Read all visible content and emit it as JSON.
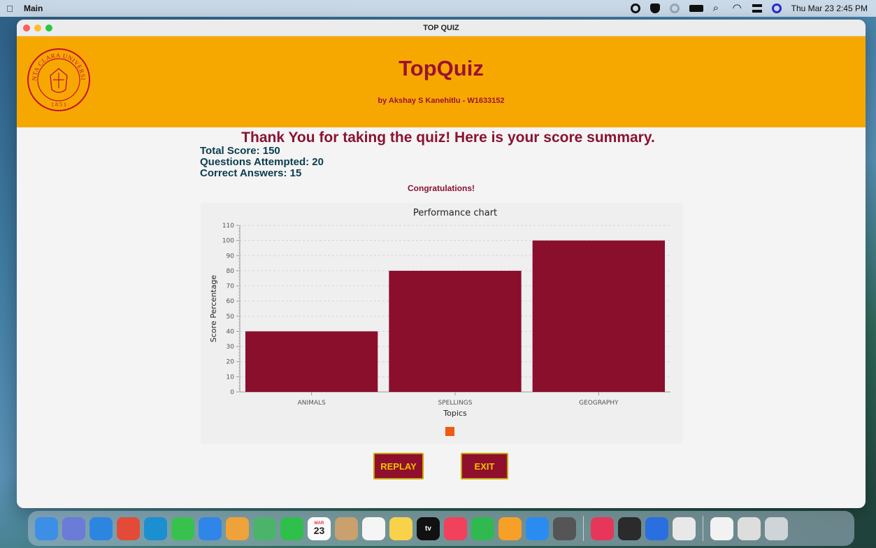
{
  "menubar": {
    "app_name": "Main",
    "clock": "Thu Mar 23  2:45 PM"
  },
  "window": {
    "title": "TOP QUIZ"
  },
  "header": {
    "title": "TopQuiz",
    "subtitle": "by Akshay S Kanehitlu - W1633152",
    "logo": "santa-clara-university-seal",
    "logo_text": "SANTA CLARA UNIVERSITY",
    "logo_year": "1 8 5 1"
  },
  "summary": {
    "heading": "Thank You for taking the quiz! Here is your score summary.",
    "total_score": "Total Score: 150",
    "questions_attempted": "Questions Attempted: 20",
    "correct_answers": "Correct Answers: 15",
    "message": "Congratulations!"
  },
  "chart_data": {
    "type": "bar",
    "title": "Performance chart",
    "xlabel": "Topics",
    "ylabel": "Score Percentage",
    "categories": [
      "ANIMALS",
      "SPELLINGS",
      "GEOGRAPHY"
    ],
    "values": [
      40,
      80,
      100
    ],
    "ylim": [
      0,
      110
    ],
    "yticks": [
      0,
      10,
      20,
      30,
      40,
      50,
      60,
      70,
      80,
      90,
      100,
      110
    ],
    "grid": true,
    "bar_color": "#8a0f2c",
    "legend_color": "#f05a12",
    "legend_placement": "bottom-center"
  },
  "buttons": {
    "replay": "REPLAY",
    "exit": "EXIT"
  },
  "colors": {
    "header_bg": "#f7a800",
    "brand_red": "#9b1233",
    "button_text": "#f2c200"
  },
  "dock": {
    "items": [
      "finder",
      "launchpad",
      "safari",
      "chrome",
      "edge",
      "messages",
      "mail",
      "photos",
      "maps",
      "facetime",
      "calendar",
      "contacts",
      "reminders",
      "notes",
      "tv",
      "music",
      "numbers",
      "pages",
      "app-store",
      "calculator",
      "intellij",
      "terminal",
      "xcode",
      "java",
      "preview",
      "keyboard-viewer",
      "trash"
    ],
    "calendar_month": "MAR",
    "calendar_day": "23",
    "tv_label": "tv"
  }
}
